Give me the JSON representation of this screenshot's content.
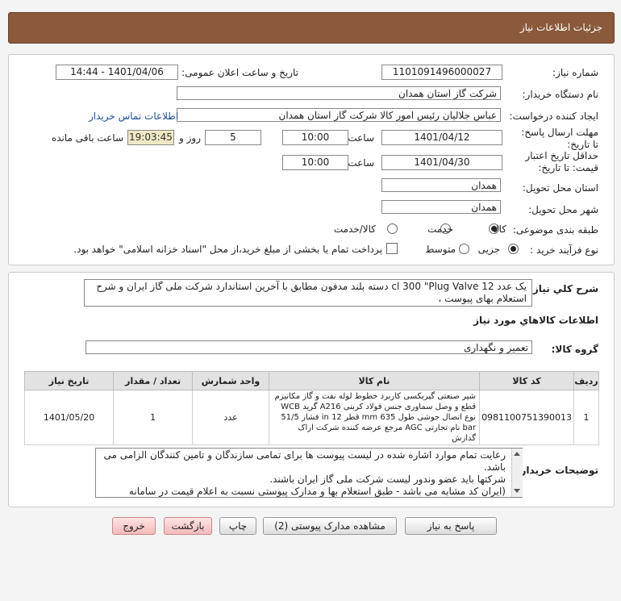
{
  "header": {
    "title": "جزئیات اطلاعات نیاز"
  },
  "form": {
    "need_number_label": "شماره نیاز:",
    "need_number": "1101091496000027",
    "announce_label": "تاریخ و ساعت اعلان عمومی:",
    "announce_value": "1401/04/06 - 14:44",
    "buyer_org_label": "نام دستگاه خریدار:",
    "buyer_org": "شرکت گاز استان همدان",
    "creator_label": "ایجاد کننده درخواست:",
    "creator": "عباس جلالیان رئیس امور کالا شرکت گاز استان همدان",
    "contact_link": "اطلاعات تماس خریدار",
    "deadline_label": "مهلت ارسال پاسخ: تا تاریخ:",
    "deadline_date": "1401/04/12",
    "time_label": "ساعت",
    "deadline_time": "10:00",
    "days": "5",
    "days_label": "روز و",
    "remaining_time": "19:03:45",
    "remaining_label": "ساعت باقی مانده",
    "validity_label": "حداقل تاریخ اعتبار قیمت: تا تاریخ:",
    "validity_date": "1401/04/30",
    "validity_time": "10:00",
    "province_label": "استان محل تحویل:",
    "province": "همدان",
    "city_label": "شهر محل تحویل:",
    "city": "همدان",
    "category_label": "طبقه بندی موضوعی:",
    "category_options": [
      "کالا",
      "خدمت",
      "کالا/خدمت"
    ],
    "category_selected": "کالا",
    "process_label": "نوع فرآیند خرید :",
    "process_options": [
      "جزیی",
      "متوسط"
    ],
    "process_selected": "جزیی",
    "treasury_note": "پرداخت تمام یا بخشی از مبلغ خرید،از محل \"اسناد خزانه اسلامی\" خواهد بود."
  },
  "summary": {
    "label": "شرح کلي نياز:",
    "text": "یک عدد cl 300 \"Plug Valve 12 دسته بلند مدفون مطابق با آخرین استاندارد شرکت ملی گاز ایران  و شرح استعلام بهای پیوست ،"
  },
  "goods": {
    "section_title": "اطلاعات کالاهاي مورد نياز",
    "group_label": "گروه کالا:",
    "group_value": "تعمیر و نگهداری",
    "columns": [
      "ردیف",
      "کد کالا",
      "نام کالا",
      "واحد شمارش",
      "تعداد / مقدار",
      "تاریخ نیاز"
    ],
    "rows": [
      {
        "row": "1",
        "code": "0981100751390013",
        "name": "شیر صنعتی گیربکسی کاربرد خطوط لوله نفت و گاز مکانیزم قطع و وصل سماوری جنس فولاد کربنی A216 گرید WCB نوع اتصال جوشی طول 635 mm قطر 12 in فشار 51/5 bar نام تجارتی AGC مرجع عرضه کننده شرکت اراک گدازش",
        "unit": "عدد",
        "qty": "1",
        "date": "1401/05/20"
      }
    ]
  },
  "buyer_notes": {
    "label": "توضیحات خریدار:",
    "lines": [
      "رعایت تمام موارد اشاره شده در لیست پیوست ها برای تمامی سازندگان و تامین کنندگان الزامی می باشد.",
      "شرکتها باید عضو وندور لیست شرکت ملی گاز  ایران باشند.",
      "(ایران کد مشابه می باشد - طبق استعلام بها و مدارک پیوستی نسبت به اعلام قیمت در سامانه"
    ]
  },
  "buttons": {
    "reply": "پاسخ به نیاز",
    "attachments": "مشاهده مدارک پیوستی (2)",
    "print": "چاپ",
    "back": "بازگشت",
    "exit": "خروج"
  }
}
